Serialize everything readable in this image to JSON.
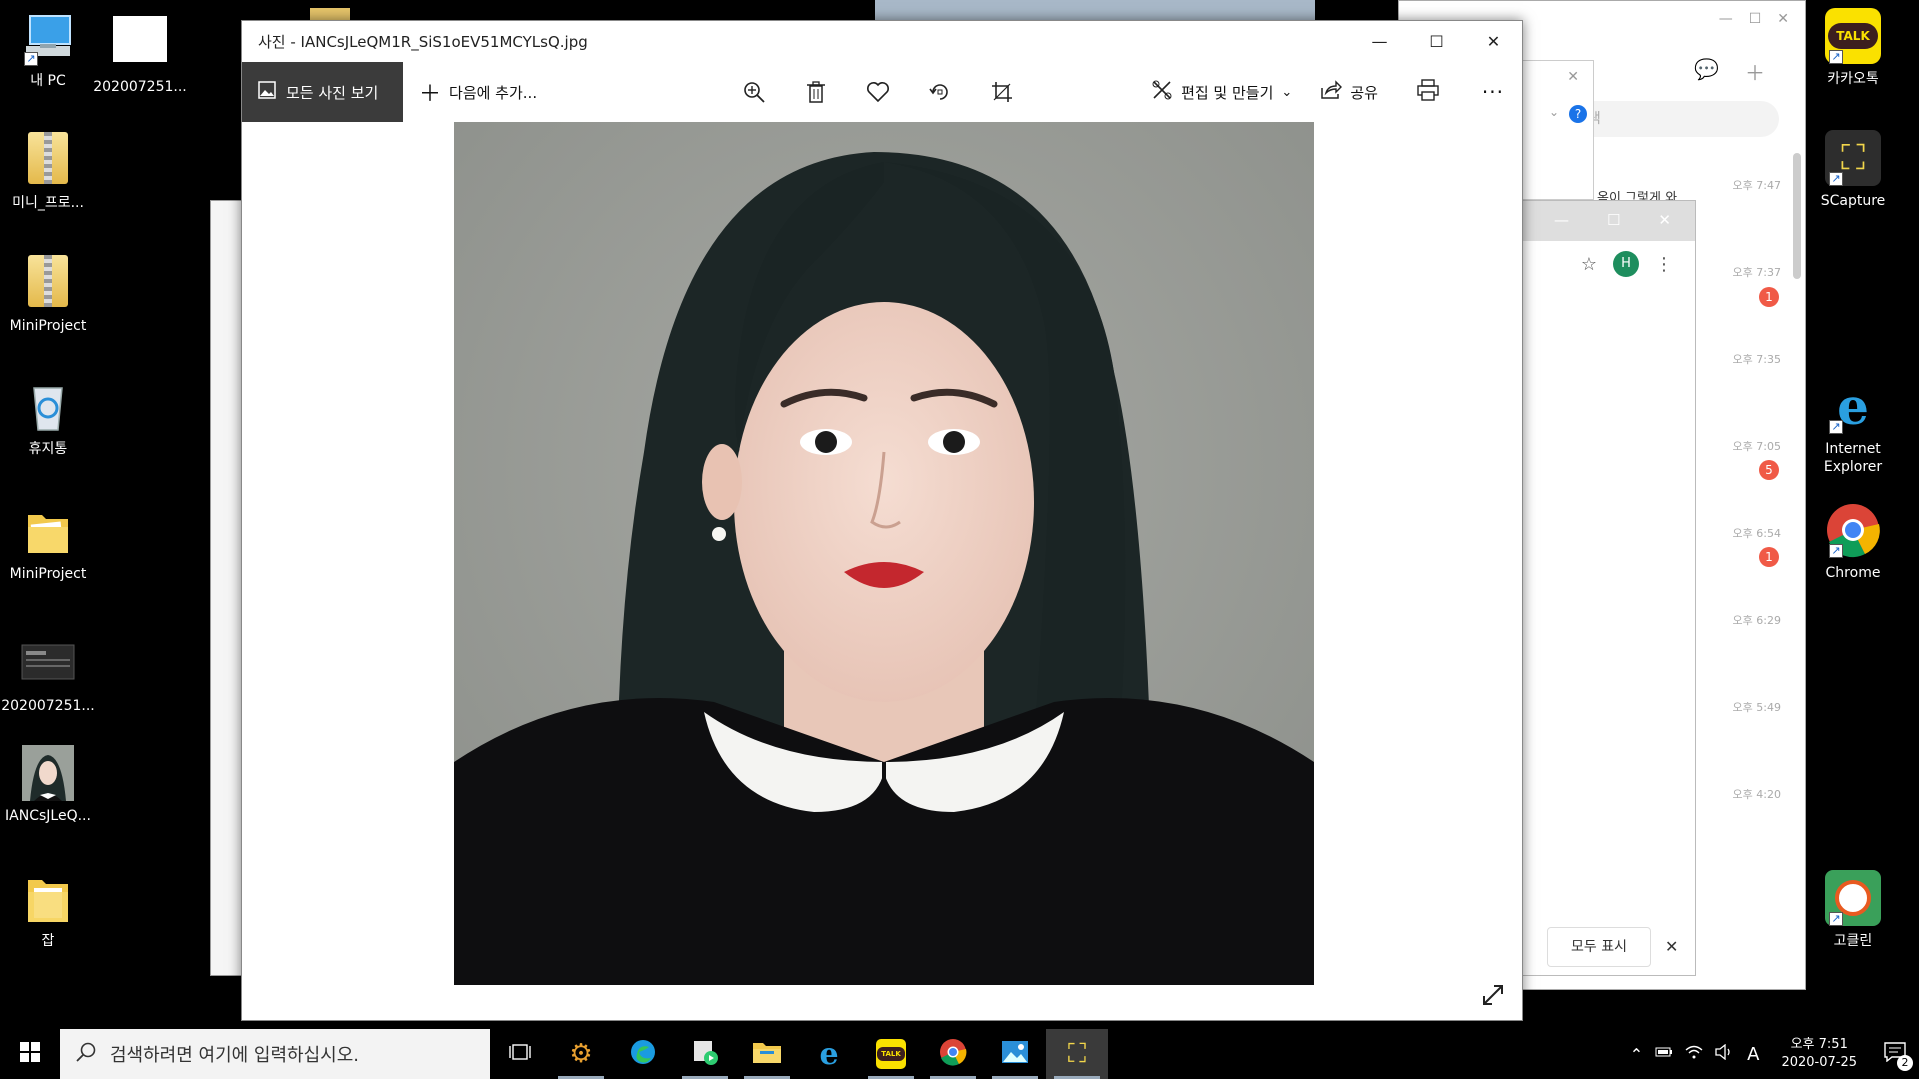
{
  "desktop_icons": [
    {
      "label": "내 PC",
      "icon": "computer-icon"
    },
    {
      "label": "202007251...",
      "icon": "image-file-icon"
    },
    {
      "label": "미니_프로...",
      "icon": "zip-folder-icon"
    },
    {
      "label": "MiniProject",
      "icon": "zip-folder-icon"
    },
    {
      "label": "휴지통",
      "icon": "recycle-bin-icon"
    },
    {
      "label": "MiniProject",
      "icon": "folder-icon"
    },
    {
      "label": "202007251...",
      "icon": "screenshot-file-icon"
    },
    {
      "label": "IANCsJLeQ...",
      "icon": "photo-file-icon"
    },
    {
      "label": "잡",
      "icon": "folder-icon"
    }
  ],
  "right_icons": [
    {
      "label": "카카오톡",
      "icon": "kakaotalk-icon"
    },
    {
      "label": "SCapture",
      "icon": "scapture-icon"
    },
    {
      "label": "Internet Explorer",
      "icon": "internet-explorer-icon"
    },
    {
      "label": "Chrome",
      "icon": "chrome-icon"
    },
    {
      "label": "고클린",
      "icon": "goclean-icon"
    }
  ],
  "kakao": {
    "search_placeholder": "검색",
    "times": [
      "오후 7:47",
      "오후 7:37",
      "오후 7:35",
      "오후 7:05",
      "오후 6:54",
      "오후 6:29",
      "오후 5:49",
      "오후 4:20"
    ],
    "badges": [
      "1",
      "5",
      "1"
    ],
    "snippet": "옥이 그렇게 와"
  },
  "chrome_bg": {
    "avatar": "H",
    "download_show_all": "모두 표시"
  },
  "photos": {
    "title": "사진 - IANCsJLeQM1R_SiS1oEV51MCYLsQ.jpg",
    "all_photos": "모든 사진 보기",
    "add_to": "다음에 추가...",
    "edit_create": "편집 및 만들기",
    "share": "공유"
  },
  "taskbar": {
    "search_placeholder": "검색하려면 여기에 입력하십시오.",
    "time_period": "오후 7:51",
    "date": "2020-07-25",
    "ime": "A",
    "notification_count": "2"
  },
  "colors": {
    "accent_toolbar": "#3b3b3b",
    "kakao_yellow": "#fae100",
    "badge_red": "#f05a47"
  }
}
